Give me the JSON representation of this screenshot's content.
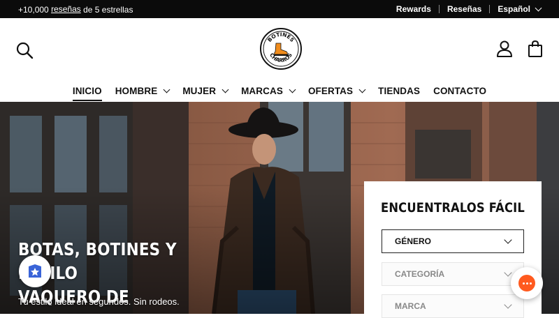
{
  "topbar": {
    "left_prefix": "+10,000",
    "left_link": "reseñas",
    "left_suffix": "de 5 estrellas",
    "rewards": "Rewards",
    "reviews": "Reseñas",
    "language": "Español"
  },
  "header": {
    "logo_top": "Botines",
    "logo_bottom": "Charros"
  },
  "nav": {
    "items": [
      {
        "label": "INICIO"
      },
      {
        "label": "HOMBRE"
      },
      {
        "label": "MUJER"
      },
      {
        "label": "MARCAS"
      },
      {
        "label": "OFERTAS"
      },
      {
        "label": "TIENDAS"
      },
      {
        "label": "CONTACTO"
      }
    ]
  },
  "hero": {
    "title_line1": "BOTAS, BOTINES Y ESTILO",
    "title_line2": "VAQUERO DE VERDAD",
    "subtitle": "Tu estilo ideal en segundos. Sin rodeos."
  },
  "finder": {
    "title": "ENCUENTRALOS FÁCIL",
    "gender": "GÉNERO",
    "category": "CATEGORÍA",
    "brand": "MARCA"
  },
  "colors": {
    "topbar_bg": "#0b0b0b",
    "chat_accent": "#ff5a1f",
    "text": "#111111"
  }
}
